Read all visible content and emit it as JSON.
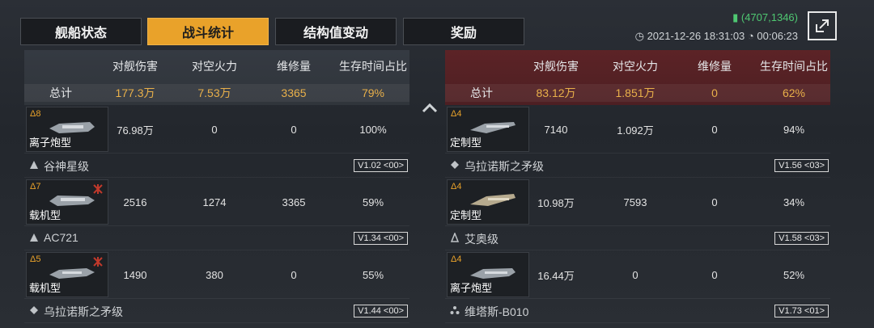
{
  "tabs": [
    {
      "label": "舰船状态",
      "active": false
    },
    {
      "label": "战斗统计",
      "active": true
    },
    {
      "label": "结构值变动",
      "active": false
    },
    {
      "label": "奖励",
      "active": false
    }
  ],
  "meta": {
    "coord": "(4707,1346)",
    "datetime": "2021-12-26 18:31:03",
    "duration": "00:06:23"
  },
  "columns": [
    "对舰伤害",
    "对空火力",
    "维修量",
    "生存时间占比"
  ],
  "total_label": "总计",
  "left": {
    "totals": [
      "177.3万",
      "7.53万",
      "3365",
      "79%"
    ],
    "top_row": {
      "rank": "Δ8",
      "type": "离子炮型",
      "values": [
        "76.98万",
        "0",
        "0",
        "100%"
      ]
    },
    "groups": [
      {
        "name": "谷神星级",
        "version": "V1.02 <00>",
        "row": {
          "rank": "Δ7",
          "type": "载机型",
          "values": [
            "2516",
            "1274",
            "3365",
            "59%"
          ]
        }
      },
      {
        "name": "AC721",
        "version": "V1.34 <00>",
        "row": {
          "rank": "Δ5",
          "type": "载机型",
          "values": [
            "1490",
            "380",
            "0",
            "55%"
          ]
        }
      },
      {
        "name": "乌拉诺斯之矛级",
        "version": "V1.44 <00>",
        "row": null
      }
    ]
  },
  "right": {
    "totals": [
      "83.12万",
      "1.851万",
      "0",
      "62%"
    ],
    "top_row": {
      "rank": "Δ4",
      "type": "定制型",
      "values": [
        "7140",
        "1.092万",
        "0",
        "94%"
      ]
    },
    "groups": [
      {
        "name": "乌拉诺斯之矛级",
        "version": "V1.56 <03>",
        "row": {
          "rank": "Δ4",
          "type": "定制型",
          "values": [
            "10.98万",
            "7593",
            "0",
            "34%"
          ]
        }
      },
      {
        "name": "艾奥级",
        "version": "V1.58 <03>",
        "row": {
          "rank": "Δ4",
          "type": "离子炮型",
          "values": [
            "16.44万",
            "0",
            "0",
            "52%"
          ]
        }
      },
      {
        "name": "维塔斯-B010",
        "version": "V1.73 <01>",
        "row": null
      }
    ]
  },
  "colors": {
    "accent": "#e9a22a",
    "enemy_header": "#5c2326",
    "value_gold": "#e9b04a",
    "coord_green": "#4fc872"
  }
}
